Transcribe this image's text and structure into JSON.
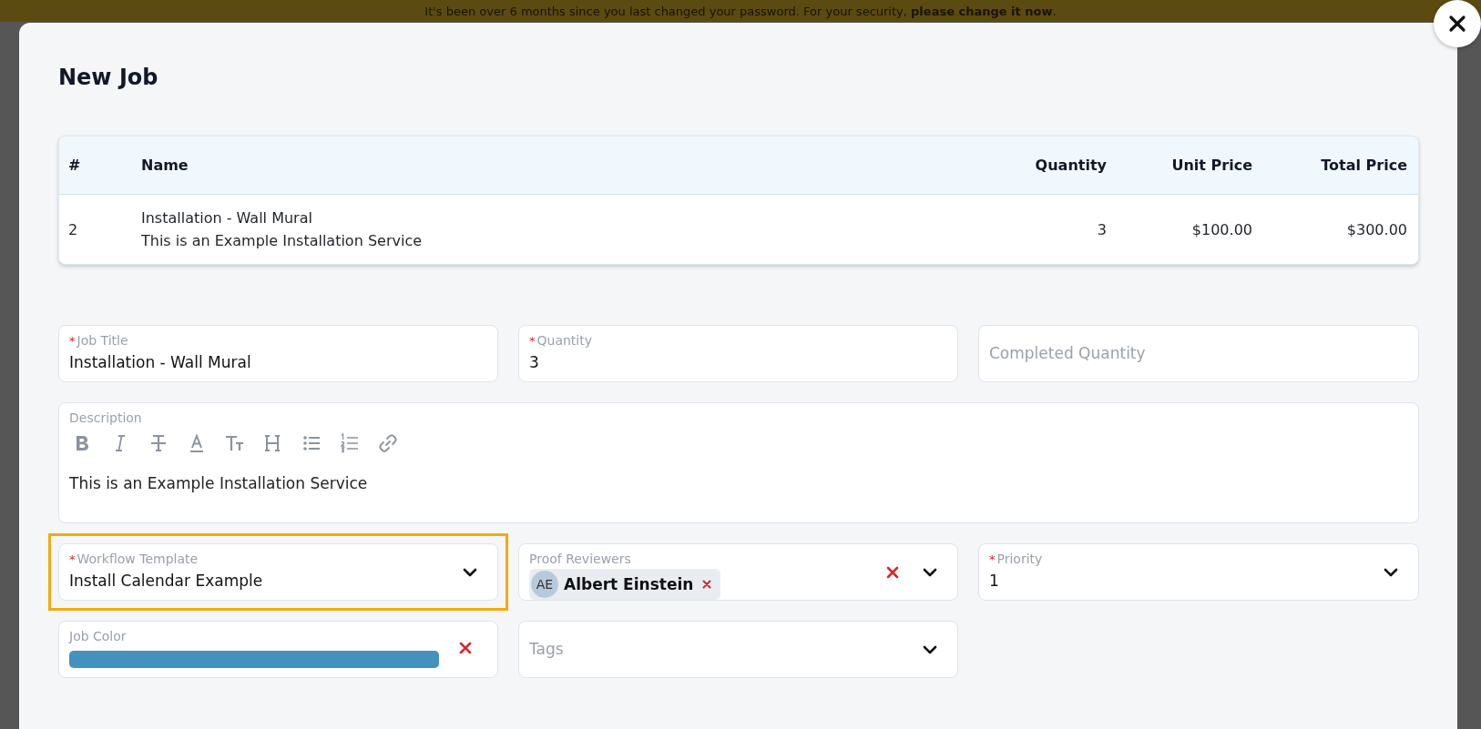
{
  "banner": {
    "text": "It's been over 6 months since you last changed your password. For your security, **please change it now**."
  },
  "modal": {
    "title": "New Job",
    "table": {
      "columns": [
        {
          "label": "#"
        },
        {
          "label": "Name"
        },
        {
          "label": "Quantity"
        },
        {
          "label": "Unit Price"
        },
        {
          "label": "Total Price"
        }
      ],
      "rows": [
        {
          "number": "2",
          "name": "Installation - Wall Mural",
          "description": "This is an Example Installation Service",
          "quantity": "3",
          "unit_price": "$100.00",
          "total_price": "$300.00"
        }
      ]
    },
    "fields": [
      {
        "kind": "text",
        "label": "Job Title",
        "required_mark": "*",
        "highlighted": false,
        "value": "Installation - Wall Mural"
      },
      {
        "kind": "text",
        "label": "Quantity",
        "required_mark": "*",
        "highlighted": false,
        "value": "3"
      },
      {
        "kind": "text",
        "placeholder": "Completed Quantity",
        "highlighted": false
      },
      {
        "kind": "richtext",
        "label": "Description",
        "highlighted": false,
        "value": "This is an Example Installation Service"
      },
      {
        "kind": "select",
        "label": "Workflow Template",
        "required_mark": "*",
        "highlighted": true,
        "value": "Install Calendar Example"
      },
      {
        "kind": "multiselect",
        "label": "Proof Reviewers",
        "highlighted": false,
        "chips": [
          {
            "initials": "AE",
            "name": "Albert Einstein"
          }
        ]
      },
      {
        "kind": "select",
        "label": "Priority",
        "required_mark": "*",
        "highlighted": false,
        "value": "1"
      },
      {
        "kind": "color",
        "label": "Job Color",
        "highlighted": false,
        "color": "#4391be"
      },
      {
        "kind": "select",
        "placeholder": "Tags",
        "highlighted": false
      }
    ]
  }
}
